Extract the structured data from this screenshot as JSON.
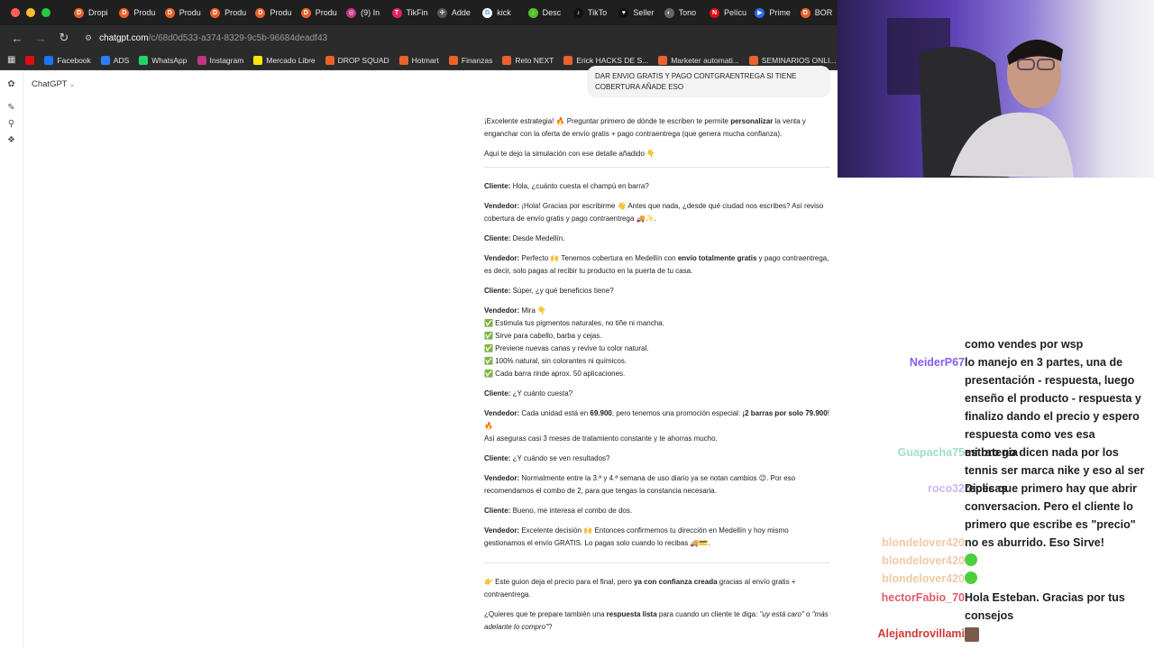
{
  "browser": {
    "tabs": [
      {
        "label": "Dropi",
        "color": "#e9622a",
        "glyph": "D"
      },
      {
        "label": "Produ",
        "color": "#e9622a",
        "glyph": "D"
      },
      {
        "label": "Produ",
        "color": "#e9622a",
        "glyph": "D"
      },
      {
        "label": "Produ",
        "color": "#e9622a",
        "glyph": "D"
      },
      {
        "label": "Produ",
        "color": "#e9622a",
        "glyph": "D"
      },
      {
        "label": "Produ",
        "color": "#e9622a",
        "glyph": "D"
      },
      {
        "label": "(9) In",
        "color": "#c13584",
        "glyph": "◎"
      },
      {
        "label": "TikFin",
        "color": "#e0245e",
        "glyph": "T"
      },
      {
        "label": "Adde",
        "color": "#555555",
        "glyph": "✣"
      },
      {
        "label": "kick",
        "color": "#ffffff",
        "glyph": "G"
      },
      {
        "label": "Desc",
        "color": "#53c22b",
        "glyph": "↓"
      },
      {
        "label": "TikTo",
        "color": "#111111",
        "glyph": "♪"
      },
      {
        "label": "Seller",
        "color": "#111111",
        "glyph": "♥"
      },
      {
        "label": "Tono",
        "color": "#666666",
        "glyph": "◐"
      },
      {
        "label": "Pelícu",
        "color": "#e50914",
        "glyph": "N"
      },
      {
        "label": "Prime",
        "color": "#2c6bed",
        "glyph": "▶"
      },
      {
        "label": "BOR",
        "color": "#e9622a",
        "glyph": "D"
      }
    ],
    "url_host": "chatgpt.com",
    "url_path": "/c/68d0d533-a374-8329-9c5b-96684deadf43",
    "bookmarks": [
      {
        "label": "",
        "color": "#e50914"
      },
      {
        "label": "Facebook",
        "color": "#1877f2"
      },
      {
        "label": "ADS",
        "color": "#2d7ff9"
      },
      {
        "label": "WhatsApp",
        "color": "#25d366"
      },
      {
        "label": "Instagram",
        "color": "#c13584"
      },
      {
        "label": "Mercado Libre",
        "color": "#ffe600"
      },
      {
        "label": "DROP SQUAD",
        "color": "#e9622a"
      },
      {
        "label": "Hotmart",
        "color": "#e9622a"
      },
      {
        "label": "Finanzas",
        "color": "#e9622a"
      },
      {
        "label": "Reto NEXT",
        "color": "#e9622a"
      },
      {
        "label": "Erick HACKS DE S...",
        "color": "#e9622a"
      },
      {
        "label": "Marketer automati...",
        "color": "#e9622a"
      },
      {
        "label": "SEMINARIOS ONLI...",
        "color": "#e9622a"
      }
    ]
  },
  "chatgpt": {
    "model": "ChatGPT",
    "user_message": "DAR ENVIO GRATIS Y PAGO CONTGRAENTREGA SI TIENE COBERTURA AÑADE ESO",
    "intro": [
      {
        "pre": "¡Excelente estrategia! 🔥 Preguntar primero de dónde te escriben te permite ",
        "bold": "personalizar",
        "post": " la venta y enganchar con la oferta de envío gratis + pago contraentrega (que genera mucha confianza)."
      },
      {
        "pre": "Aquí te dejo la simulación con ese detalle añadido 👇",
        "bold": "",
        "post": ""
      }
    ],
    "dialogue": [
      {
        "speaker": "Cliente:",
        "parts": [
          [
            "n",
            "Hola, ¿cuánto cuesta el champú en barra?"
          ]
        ]
      },
      {
        "speaker": "Vendedor:",
        "parts": [
          [
            "n",
            "¡Hola! Gracias por escribirme 👋 Antes que nada, ¿desde qué ciudad nos escribes? Así reviso cobertura de envío gratis y pago contraentrega 🚚✨."
          ]
        ]
      },
      {
        "speaker": "Cliente:",
        "parts": [
          [
            "n",
            "Desde Medellín."
          ]
        ]
      },
      {
        "speaker": "Vendedor:",
        "parts": [
          [
            "n",
            "Perfecto 🙌 Tenemos cobertura en Medellín con "
          ],
          [
            "b",
            "envío totalmente gratis"
          ],
          [
            "n",
            " y pago contraentrega, es decir, solo pagas al recibir tu producto en la puerta de tu casa."
          ]
        ]
      },
      {
        "speaker": "Cliente:",
        "parts": [
          [
            "n",
            "Súper, ¿y qué beneficios tiene?"
          ]
        ]
      },
      {
        "speaker": "Vendedor:",
        "parts": [
          [
            "n",
            "Mira 👇"
          ]
        ],
        "list": [
          "✅ Estimula tus pigmentos naturales, no tiñe ni mancha.",
          "✅ Sirve para cabello, barba y cejas.",
          "✅ Previene nuevas canas y revive tu color natural.",
          "✅ 100% natural, sin colorantes ni químicos.",
          "✅ Cada barra rinde aprox. 50 aplicaciones."
        ]
      },
      {
        "speaker": "Cliente:",
        "parts": [
          [
            "n",
            "¿Y cuánto cuesta?"
          ]
        ]
      },
      {
        "speaker": "Vendedor:",
        "parts": [
          [
            "n",
            "Cada unidad está en "
          ],
          [
            "b",
            "69.900"
          ],
          [
            "n",
            ", pero tenemos una promoción especial: "
          ],
          [
            "b",
            "¡2 barras por solo 79.900"
          ],
          [
            "n",
            "! 🔥"
          ]
        ],
        "after": "Así aseguras casi 3 meses de tratamiento constante y te ahorras mucho."
      },
      {
        "speaker": "Cliente:",
        "parts": [
          [
            "n",
            "¿Y cuándo se ven resultados?"
          ]
        ]
      },
      {
        "speaker": "Vendedor:",
        "parts": [
          [
            "n",
            "Normalmente entre la 3.ª y 4.ª semana de uso diario ya se notan cambios 😉. Por eso recomendamos el combo de 2, para que tengas la constancia necesaria."
          ]
        ]
      },
      {
        "speaker": "Cliente:",
        "parts": [
          [
            "n",
            "Bueno, me interesa el combo de dos."
          ]
        ]
      },
      {
        "speaker": "Vendedor:",
        "parts": [
          [
            "n",
            "Excelente decisión 🙌 Entonces confirmemos tu dirección en Medellín y hoy mismo gestionamos el envío GRATIS. Lo pagas solo cuando lo recibas 🚚💳."
          ]
        ]
      }
    ],
    "outro_1": {
      "pre": "👉 Este guion deja el precio para el final, pero ",
      "bold": "ya con confianza creada",
      "post": " gracias al envío gratis + contraentrega."
    },
    "outro_2": {
      "pre": "¿Quieres que te prepare también una ",
      "bold": "respuesta lista",
      "mid": " para cuando un cliente te diga: ",
      "italic1": "\"uy está caro\"",
      "mid2": " o ",
      "italic2": "\"más adelante lo compro\"",
      "post": "?"
    }
  },
  "stream_chat": [
    {
      "user": "",
      "color": "#6b6b6b",
      "text": "como vendes por wsp",
      "emote": ""
    },
    {
      "user": "NeiderP67",
      "color": "#8a5cf6",
      "text": "lo manejo en 3 partes, una de presentación - respuesta, luego enseño el producto - respuesta y finalizo dando el precio y espero respuesta como ves esa estrategia",
      "emote": ""
    },
    {
      "user": "Guapacha75",
      "color": "#9fe0c8",
      "text": "mi bro no dicen nada por los tennis ser marca nike y eso al ser replicas",
      "emote": ""
    },
    {
      "user": "roco32",
      "color": "#c9b8f2",
      "text": "Dices que primero hay que abrir conversacion. Pero el cliente lo primero que escribe es \"precio\"",
      "emote": ""
    },
    {
      "user": "blondelover420",
      "color": "#f1c9a6",
      "text": "no es aburrido. Eso Sirve!",
      "emote": ""
    },
    {
      "user": "blondelover420",
      "color": "#f1c9a6",
      "text": "",
      "emote": "green"
    },
    {
      "user": "blondelover420",
      "color": "#f1c9a6",
      "text": "",
      "emote": "green"
    },
    {
      "user": "hectorFabio_70",
      "color": "#e05a6a",
      "text": "Hola Esteban. Gracias por tus consejos",
      "emote": ""
    },
    {
      "user": "Alejandrovillami",
      "color": "#d23a3a",
      "text": "",
      "emote": "avatar"
    }
  ]
}
